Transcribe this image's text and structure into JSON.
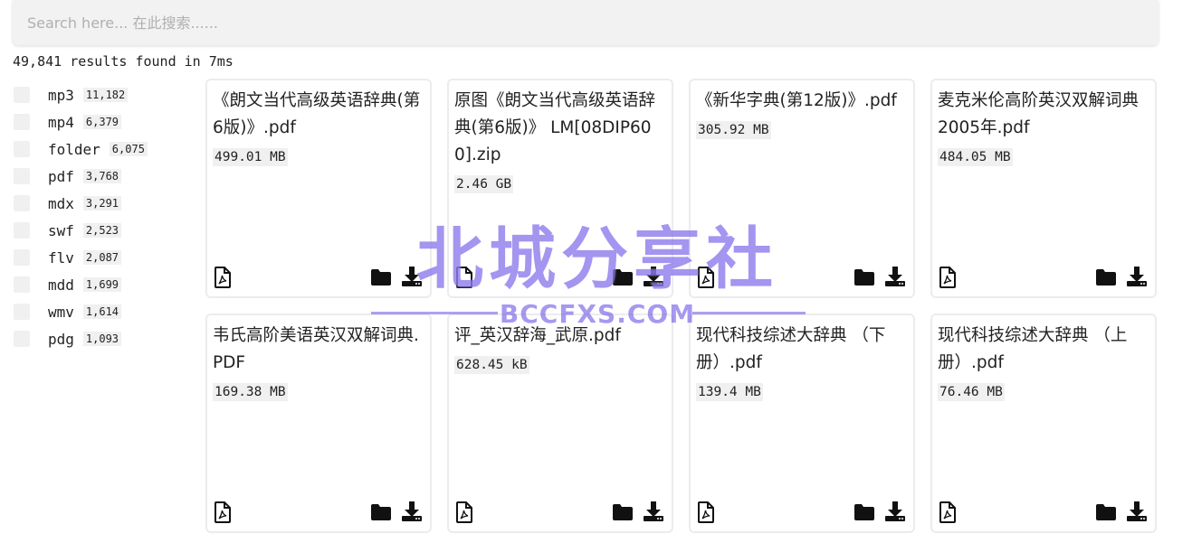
{
  "search": {
    "placeholder": "Search here... 在此搜索......"
  },
  "results_text": "49,841 results found in 7ms",
  "filters": [
    {
      "name": "mp3",
      "count": "11,182"
    },
    {
      "name": "mp4",
      "count": "6,379"
    },
    {
      "name": "folder",
      "count": "6,075"
    },
    {
      "name": "pdf",
      "count": "3,768"
    },
    {
      "name": "mdx",
      "count": "3,291"
    },
    {
      "name": "swf",
      "count": "2,523"
    },
    {
      "name": "flv",
      "count": "2,087"
    },
    {
      "name": "mdd",
      "count": "1,699"
    },
    {
      "name": "wmv",
      "count": "1,614"
    },
    {
      "name": "pdg",
      "count": "1,093"
    }
  ],
  "cards": [
    {
      "title": "《朗文当代高级英语辞典(第6版)》.pdf",
      "size": "499.01 MB",
      "file_icon": "pdf-file-icon"
    },
    {
      "title": "原图《朗文当代高级英语辞典(第6版)》 LM[08DIP600].zip",
      "size": "2.46 GB",
      "file_icon": "file-icon"
    },
    {
      "title": "《新华字典(第12版)》.pdf",
      "size": "305.92 MB",
      "file_icon": "pdf-file-icon"
    },
    {
      "title": "麦克米伦高阶英汉双解词典 2005年.pdf",
      "size": "484.05 MB",
      "file_icon": "pdf-file-icon"
    },
    {
      "title": "韦氏高阶美语英汉双解词典.PDF",
      "size": "169.38 MB",
      "file_icon": "pdf-file-icon"
    },
    {
      "title": "评_英汉辞海_武原.pdf",
      "size": "628.45 kB",
      "file_icon": "pdf-file-icon"
    },
    {
      "title": "现代科技综述大辞典 （下册）.pdf",
      "size": "139.4 MB",
      "file_icon": "pdf-file-icon"
    },
    {
      "title": "现代科技综述大辞典 （上册）.pdf",
      "size": "76.46 MB",
      "file_icon": "pdf-file-icon"
    }
  ],
  "watermark": {
    "cn": "北城分享社",
    "en": "BCCFXS.COM"
  }
}
